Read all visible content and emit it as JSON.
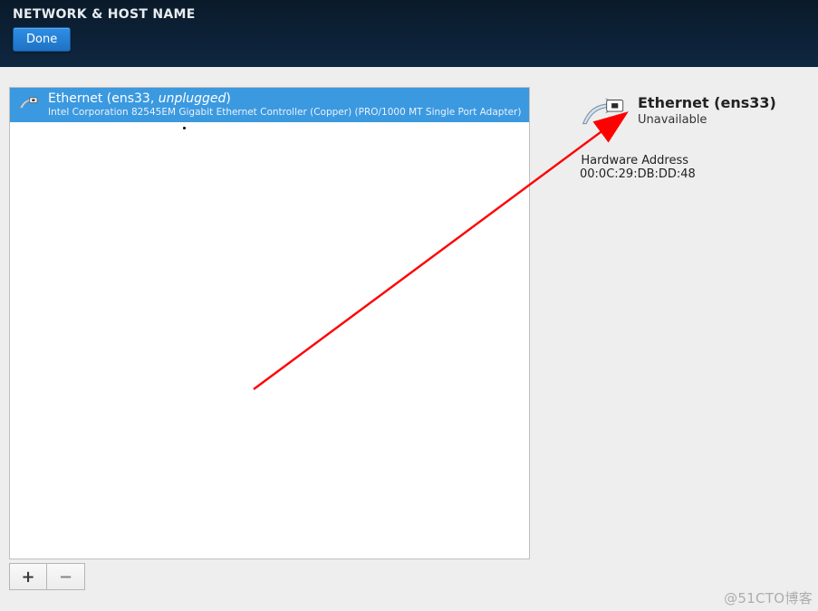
{
  "header": {
    "title": "NETWORK & HOST NAME",
    "done_label": "Done"
  },
  "devices": {
    "items": [
      {
        "name_prefix": "Ethernet (",
        "iface": "ens33",
        "sep": ", ",
        "state": "unplugged",
        "name_suffix": ")",
        "description": "Intel Corporation 82545EM Gigabit Ethernet Controller (Copper) (PRO/1000 MT Single Port Adapter)"
      }
    ]
  },
  "buttons": {
    "add": "+",
    "remove": "−"
  },
  "details": {
    "title": "Ethernet (ens33)",
    "status": "Unavailable",
    "hw_label": "Hardware Address",
    "hw_value": "00:0C:29:DB:DD:48"
  },
  "watermark": "@51CTO博客"
}
